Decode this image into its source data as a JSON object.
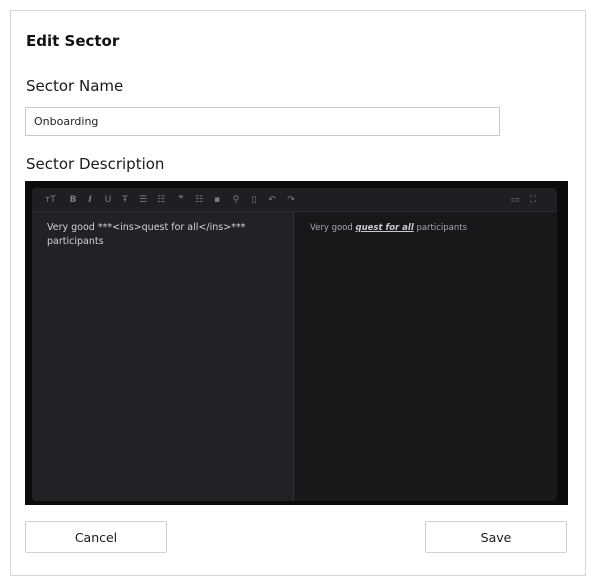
{
  "dialog": {
    "title": "Edit Sector",
    "name_label": "Sector Name",
    "name_value": "Onboarding",
    "description_label": "Sector Description"
  },
  "editor": {
    "toolbar": {
      "heading": "ᴛT",
      "bold": "B",
      "italic": "I",
      "underline": "U",
      "strike": "Ŧ",
      "unordered_list": "☰",
      "ordered_list": "☷",
      "quote": "❞",
      "checklist": "☷",
      "image": "▪",
      "link": "⚲",
      "table": "▯",
      "undo": "↶",
      "redo": "↷",
      "preview": "▭",
      "fullscreen": "⛶"
    },
    "source_text": "Very good ***<ins>quest for all</ins>*** participants",
    "preview_before": "Very good ",
    "preview_emphasis": "quest for all",
    "preview_after": " participants"
  },
  "actions": {
    "cancel_label": "Cancel",
    "save_label": "Save"
  }
}
